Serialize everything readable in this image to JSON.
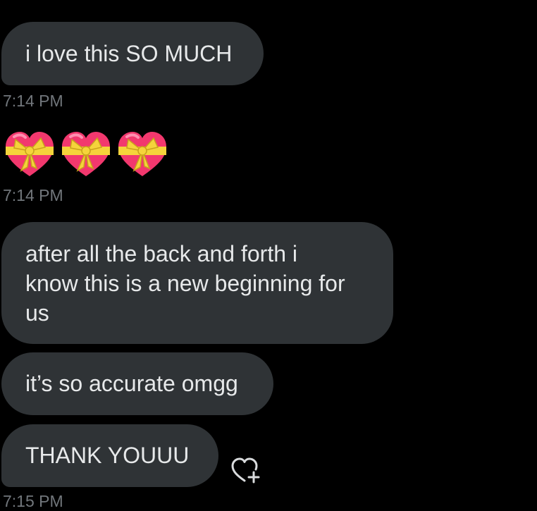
{
  "messages": [
    {
      "id": "msg1",
      "text": "i love this SO MUCH"
    },
    {
      "id": "msg3",
      "text": "after all the back and forth i\nknow this is a new beginning for\nus"
    },
    {
      "id": "msg4",
      "text": "it’s so accurate omgg"
    },
    {
      "id": "msg5",
      "text": "THANK YOUUU"
    }
  ],
  "timestamps": [
    "7:14 PM",
    "7:14 PM",
    "7:15 PM"
  ],
  "emoji_message": {
    "icons": [
      "heart-with-ribbon-icon",
      "heart-with-ribbon-icon",
      "heart-with-ribbon-icon"
    ]
  },
  "reaction_icon": "add-reaction-heart-icon",
  "colors": {
    "background": "#000000",
    "bubble": "#2f3336",
    "text": "#e7e9ea",
    "timestamp": "#71767b",
    "heart": "#f2386e",
    "ribbon": "#f5d33b"
  }
}
